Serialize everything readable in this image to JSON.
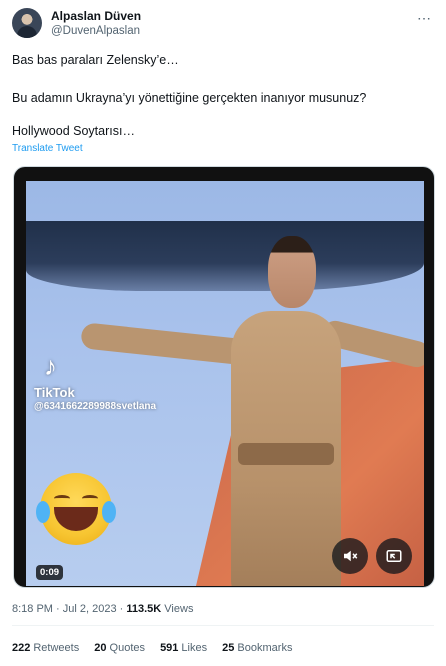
{
  "author": {
    "name": "Alpaslan Düven",
    "handle": "@DuvenAlpaslan",
    "more_icon": "ellipsis-icon"
  },
  "tweet": {
    "line1": "Bas bas paraları Zelensky’e…",
    "line2": "Bu adamın Ukrayna’yı yönettiğine gerçekten inanıyor musunuz?",
    "line3": "Hollywood Soytarısı…",
    "translate_link": "Translate Tweet"
  },
  "media": {
    "watermark_brand": "TikTok",
    "watermark_user": "@6341662289988svetlana",
    "duration": "0:09",
    "mute_icon": "speaker-muted-icon",
    "pip_icon": "picture-in-picture-icon"
  },
  "meta": {
    "time": "8:18 PM",
    "separator1": " · ",
    "date": "Jul 2, 2023",
    "separator2": " · ",
    "views_count": "113.5K",
    "views_label": "Views"
  },
  "stats": [
    {
      "count": "222",
      "label": "Retweets"
    },
    {
      "count": "20",
      "label": "Quotes"
    },
    {
      "count": "591",
      "label": "Likes"
    },
    {
      "count": "25",
      "label": "Bookmarks"
    }
  ],
  "colors": {
    "link": "#1d9bf0",
    "secondary_text": "#536471",
    "primary_text": "#0f1419"
  }
}
